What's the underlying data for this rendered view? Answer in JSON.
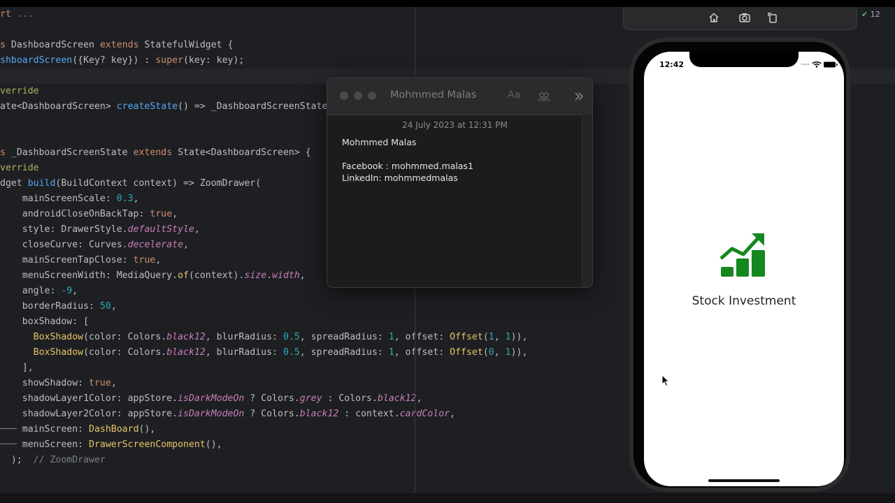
{
  "editor": {
    "lines": [
      {
        "id": "l1",
        "parts": [
          [
            "kw",
            "rt"
          ],
          [
            "gray",
            " ..."
          ]
        ]
      },
      {
        "id": "l2",
        "parts": [
          [
            "kw",
            "s "
          ],
          [
            "cls",
            "DashboardScreen "
          ],
          [
            "kw",
            "extends "
          ],
          [
            "cls",
            "StatefulWidget {"
          ]
        ]
      },
      {
        "id": "l3",
        "parts": [
          [
            "fn",
            "shboardScreen"
          ],
          [
            "cls",
            "({Key? key}) : "
          ],
          [
            "kw",
            "super"
          ],
          [
            "cls",
            "(key: key);"
          ]
        ]
      },
      {
        "id": "l4",
        "parts": [
          [
            "ann",
            "verride"
          ]
        ]
      },
      {
        "id": "l5",
        "parts": [
          [
            "cls",
            "ate<DashboardScreen> "
          ],
          [
            "fn",
            "createState"
          ],
          [
            "cls",
            "() => _DashboardScreenState("
          ]
        ]
      },
      {
        "id": "l6",
        "parts": [
          [
            "kw",
            "s "
          ],
          [
            "cls",
            "_DashboardScreenState "
          ],
          [
            "kw",
            "extends "
          ],
          [
            "cls",
            "State<DashboardScreen> {"
          ]
        ]
      },
      {
        "id": "l7",
        "parts": [
          [
            "ann",
            "verride"
          ]
        ]
      },
      {
        "id": "l8",
        "parts": [
          [
            "cls",
            "dget "
          ],
          [
            "fn",
            "build"
          ],
          [
            "cls",
            "(BuildContext context) => ZoomDrawer("
          ]
        ]
      },
      {
        "id": "l9",
        "parts": [
          [
            "cls",
            "    mainScreenScale: "
          ],
          [
            "num",
            "0.3"
          ],
          [
            "cls",
            ","
          ]
        ]
      },
      {
        "id": "l10",
        "parts": [
          [
            "cls",
            "    androidCloseOnBackTap: "
          ],
          [
            "kw",
            "true"
          ],
          [
            "cls",
            ","
          ]
        ]
      },
      {
        "id": "l11",
        "parts": [
          [
            "cls",
            "    style: DrawerStyle."
          ],
          [
            "it",
            "defaultStyle"
          ],
          [
            "cls",
            ","
          ]
        ]
      },
      {
        "id": "l12",
        "parts": [
          [
            "cls",
            "    closeCurve: Curves."
          ],
          [
            "it",
            "decelerate"
          ],
          [
            "cls",
            ","
          ]
        ]
      },
      {
        "id": "l13",
        "parts": [
          [
            "cls",
            "    mainScreenTapClose: "
          ],
          [
            "kw",
            "true"
          ],
          [
            "cls",
            ","
          ]
        ]
      },
      {
        "id": "l14",
        "parts": [
          [
            "cls",
            "    menuScreenWidth: MediaQuery."
          ],
          [
            "yl",
            "of"
          ],
          [
            "cls",
            "(context)."
          ],
          [
            "it",
            "size"
          ],
          [
            "cls",
            "."
          ],
          [
            "it",
            "width"
          ],
          [
            "cls",
            ","
          ]
        ]
      },
      {
        "id": "l15",
        "parts": [
          [
            "cls",
            "    angle: "
          ],
          [
            "num",
            "-9"
          ],
          [
            "cls",
            ","
          ]
        ]
      },
      {
        "id": "l16",
        "parts": [
          [
            "cls",
            "    borderRadius: "
          ],
          [
            "num",
            "50"
          ],
          [
            "cls",
            ","
          ]
        ]
      },
      {
        "id": "l17",
        "parts": [
          [
            "cls",
            "    boxShadow: ["
          ]
        ]
      },
      {
        "id": "l18",
        "parts": [
          [
            "cls",
            "      "
          ],
          [
            "yl",
            "BoxShadow"
          ],
          [
            "cls",
            "(color: Colors."
          ],
          [
            "it",
            "black12"
          ],
          [
            "cls",
            ", blurRadius: "
          ],
          [
            "num",
            "0.5"
          ],
          [
            "cls",
            ", spreadRadius: "
          ],
          [
            "num",
            "1"
          ],
          [
            "cls",
            ", offset: "
          ],
          [
            "yl",
            "Offset"
          ],
          [
            "cls",
            "("
          ],
          [
            "num",
            "1"
          ],
          [
            "cls",
            ", "
          ],
          [
            "num",
            "1"
          ],
          [
            "cls",
            "))"
          ],
          [
            "cls",
            ","
          ]
        ]
      },
      {
        "id": "l19",
        "parts": [
          [
            "cls",
            "      "
          ],
          [
            "yl",
            "BoxShadow"
          ],
          [
            "cls",
            "(color: Colors."
          ],
          [
            "it",
            "black12"
          ],
          [
            "cls",
            ", blurRadius: "
          ],
          [
            "num",
            "0.5"
          ],
          [
            "cls",
            ", spreadRadius: "
          ],
          [
            "num",
            "1"
          ],
          [
            "cls",
            ", offset: "
          ],
          [
            "yl",
            "Offset"
          ],
          [
            "cls",
            "("
          ],
          [
            "num",
            "0"
          ],
          [
            "cls",
            ", "
          ],
          [
            "num",
            "1"
          ],
          [
            "cls",
            "))"
          ],
          [
            "cls",
            ","
          ]
        ]
      },
      {
        "id": "l20",
        "parts": [
          [
            "cls",
            "    ],"
          ]
        ]
      },
      {
        "id": "l21",
        "parts": [
          [
            "cls",
            "    showShadow: "
          ],
          [
            "kw",
            "true"
          ],
          [
            "cls",
            ","
          ]
        ]
      },
      {
        "id": "l22",
        "parts": [
          [
            "cls",
            "    shadowLayer1Color: appStore."
          ],
          [
            "it",
            "isDarkModeOn"
          ],
          [
            "cls",
            " ? Colors."
          ],
          [
            "it",
            "grey"
          ],
          [
            "cls",
            " : Colors."
          ],
          [
            "it",
            "black12"
          ],
          [
            "cls",
            ","
          ]
        ]
      },
      {
        "id": "l23",
        "parts": [
          [
            "cls",
            "    shadowLayer2Color: appStore."
          ],
          [
            "it",
            "isDarkModeOn"
          ],
          [
            "cls",
            " ? Colors."
          ],
          [
            "it",
            "black12"
          ],
          [
            "cls",
            " : context."
          ],
          [
            "it",
            "cardColor"
          ],
          [
            "cls",
            ","
          ]
        ]
      },
      {
        "id": "l24",
        "parts": [
          [
            "gray",
            "─── "
          ],
          [
            "cls",
            "mainScreen: "
          ],
          [
            "yl",
            "DashBoard"
          ],
          [
            "cls",
            "(),"
          ]
        ]
      },
      {
        "id": "l25",
        "parts": [
          [
            "gray",
            "─── "
          ],
          [
            "cls",
            "menuScreen: "
          ],
          [
            "yl",
            "DrawerScreenComponent"
          ],
          [
            "cls",
            "(),"
          ]
        ]
      },
      {
        "id": "l26",
        "parts": [
          [
            "cls",
            "  );  "
          ],
          [
            "cm",
            "// ZoomDrawer"
          ]
        ]
      }
    ]
  },
  "gutter": {
    "count": "12"
  },
  "notes": {
    "title": "Mohmmed Malas",
    "font_tool": "Aa",
    "date": "24 July 2023 at 12:31 PM",
    "body_name": "Mohmmed Malas",
    "facebook": "Facebook : mohmmed.malas1",
    "linkedin": "LinkedIn: mohmmedmalas"
  },
  "phone": {
    "time": "12:42",
    "app_title": "Stock Investment",
    "accent": "#14871f"
  }
}
